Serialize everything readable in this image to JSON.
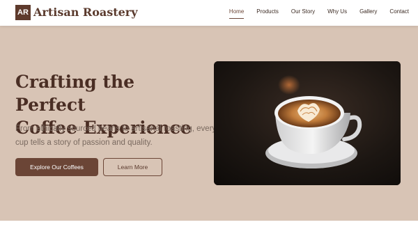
{
  "header": {
    "logo_text": "AR",
    "brand": "Artisan Roastery",
    "nav": [
      {
        "label": "Home",
        "active": true
      },
      {
        "label": "Products",
        "active": false
      },
      {
        "label": "Our Story",
        "active": false
      },
      {
        "label": "Why Us",
        "active": false
      },
      {
        "label": "Gallery",
        "active": false
      },
      {
        "label": "Contact",
        "active": false
      }
    ]
  },
  "hero": {
    "headline_line1": "Crafting the Perfect",
    "headline_line2": "Coffee Experience",
    "subtext": "From ethically sourced beans to artisanal roasting, every cup tells a story of passion and quality.",
    "primary_button": "Explore Our Coffees",
    "secondary_button": "Learn More",
    "image_subject": "latte-art-coffee-cup"
  },
  "colors": {
    "accent": "#6b4536",
    "hero_background": "#d8c4b5",
    "headline": "#4a2e24"
  }
}
